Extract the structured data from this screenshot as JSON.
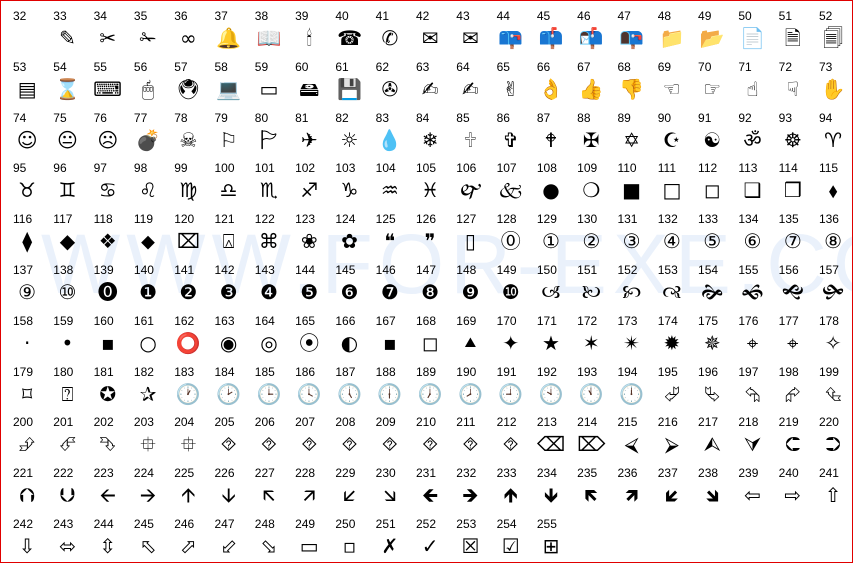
{
  "watermark": "WWW.FOR-EXE.COM",
  "symbols": [
    {
      "code": "32",
      "glyph": ""
    },
    {
      "code": "33",
      "glyph": "✎"
    },
    {
      "code": "34",
      "glyph": "✂"
    },
    {
      "code": "35",
      "glyph": "✁"
    },
    {
      "code": "36",
      "glyph": "∞"
    },
    {
      "code": "37",
      "glyph": "🔔"
    },
    {
      "code": "38",
      "glyph": "📖"
    },
    {
      "code": "39",
      "glyph": "🕯"
    },
    {
      "code": "40",
      "glyph": "☎"
    },
    {
      "code": "41",
      "glyph": "✆"
    },
    {
      "code": "42",
      "glyph": "✉"
    },
    {
      "code": "43",
      "glyph": "✉"
    },
    {
      "code": "44",
      "glyph": "📪"
    },
    {
      "code": "45",
      "glyph": "📫"
    },
    {
      "code": "46",
      "glyph": "📬"
    },
    {
      "code": "47",
      "glyph": "📭"
    },
    {
      "code": "48",
      "glyph": "📁"
    },
    {
      "code": "49",
      "glyph": "📂"
    },
    {
      "code": "50",
      "glyph": "📄"
    },
    {
      "code": "51",
      "glyph": "🗎"
    },
    {
      "code": "52",
      "glyph": "🗐"
    },
    {
      "code": "53",
      "glyph": "▤"
    },
    {
      "code": "54",
      "glyph": "⌛"
    },
    {
      "code": "55",
      "glyph": "⌨"
    },
    {
      "code": "56",
      "glyph": "🖱"
    },
    {
      "code": "57",
      "glyph": "🖲"
    },
    {
      "code": "58",
      "glyph": "💻"
    },
    {
      "code": "59",
      "glyph": "▭"
    },
    {
      "code": "60",
      "glyph": "🖴"
    },
    {
      "code": "61",
      "glyph": "💾"
    },
    {
      "code": "62",
      "glyph": "✇"
    },
    {
      "code": "63",
      "glyph": "✍"
    },
    {
      "code": "64",
      "glyph": "✍"
    },
    {
      "code": "65",
      "glyph": "✌"
    },
    {
      "code": "66",
      "glyph": "👌"
    },
    {
      "code": "67",
      "glyph": "👍"
    },
    {
      "code": "68",
      "glyph": "👎"
    },
    {
      "code": "69",
      "glyph": "☜"
    },
    {
      "code": "70",
      "glyph": "☞"
    },
    {
      "code": "71",
      "glyph": "☝"
    },
    {
      "code": "72",
      "glyph": "☟"
    },
    {
      "code": "73",
      "glyph": "✋"
    },
    {
      "code": "74",
      "glyph": "☺"
    },
    {
      "code": "75",
      "glyph": "😐"
    },
    {
      "code": "76",
      "glyph": "☹"
    },
    {
      "code": "77",
      "glyph": "💣"
    },
    {
      "code": "78",
      "glyph": "☠"
    },
    {
      "code": "79",
      "glyph": "⚐"
    },
    {
      "code": "80",
      "glyph": "🏱"
    },
    {
      "code": "81",
      "glyph": "✈"
    },
    {
      "code": "82",
      "glyph": "☼"
    },
    {
      "code": "83",
      "glyph": "💧"
    },
    {
      "code": "84",
      "glyph": "❄"
    },
    {
      "code": "85",
      "glyph": "🕆"
    },
    {
      "code": "86",
      "glyph": "✞"
    },
    {
      "code": "87",
      "glyph": "🕈"
    },
    {
      "code": "88",
      "glyph": "✠"
    },
    {
      "code": "89",
      "glyph": "✡"
    },
    {
      "code": "90",
      "glyph": "☪"
    },
    {
      "code": "91",
      "glyph": "☯"
    },
    {
      "code": "92",
      "glyph": "ॐ"
    },
    {
      "code": "93",
      "glyph": "☸"
    },
    {
      "code": "94",
      "glyph": "♈"
    },
    {
      "code": "95",
      "glyph": "♉"
    },
    {
      "code": "96",
      "glyph": "♊"
    },
    {
      "code": "97",
      "glyph": "♋"
    },
    {
      "code": "98",
      "glyph": "♌"
    },
    {
      "code": "99",
      "glyph": "♍"
    },
    {
      "code": "100",
      "glyph": "♎"
    },
    {
      "code": "101",
      "glyph": "♏"
    },
    {
      "code": "102",
      "glyph": "♐"
    },
    {
      "code": "103",
      "glyph": "♑"
    },
    {
      "code": "104",
      "glyph": "♒"
    },
    {
      "code": "105",
      "glyph": "♓"
    },
    {
      "code": "106",
      "glyph": "🙰"
    },
    {
      "code": "107",
      "glyph": "🙵"
    },
    {
      "code": "108",
      "glyph": "●"
    },
    {
      "code": "109",
      "glyph": "❍"
    },
    {
      "code": "110",
      "glyph": "■"
    },
    {
      "code": "111",
      "glyph": "□"
    },
    {
      "code": "112",
      "glyph": "◻"
    },
    {
      "code": "113",
      "glyph": "❑"
    },
    {
      "code": "114",
      "glyph": "❒"
    },
    {
      "code": "115",
      "glyph": "⬧"
    },
    {
      "code": "116",
      "glyph": "⧫"
    },
    {
      "code": "117",
      "glyph": "◆"
    },
    {
      "code": "118",
      "glyph": "❖"
    },
    {
      "code": "119",
      "glyph": "⬥"
    },
    {
      "code": "120",
      "glyph": "⌧"
    },
    {
      "code": "121",
      "glyph": "⍓"
    },
    {
      "code": "122",
      "glyph": "⌘"
    },
    {
      "code": "123",
      "glyph": "❀"
    },
    {
      "code": "124",
      "glyph": "✿"
    },
    {
      "code": "125",
      "glyph": "❝"
    },
    {
      "code": "126",
      "glyph": "❞"
    },
    {
      "code": "127",
      "glyph": "▯"
    },
    {
      "code": "128",
      "glyph": "⓪"
    },
    {
      "code": "129",
      "glyph": "①"
    },
    {
      "code": "130",
      "glyph": "②"
    },
    {
      "code": "131",
      "glyph": "③"
    },
    {
      "code": "132",
      "glyph": "④"
    },
    {
      "code": "133",
      "glyph": "⑤"
    },
    {
      "code": "134",
      "glyph": "⑥"
    },
    {
      "code": "135",
      "glyph": "⑦"
    },
    {
      "code": "136",
      "glyph": "⑧"
    },
    {
      "code": "137",
      "glyph": "⑨"
    },
    {
      "code": "138",
      "glyph": "⑩"
    },
    {
      "code": "139",
      "glyph": "⓿"
    },
    {
      "code": "140",
      "glyph": "❶"
    },
    {
      "code": "141",
      "glyph": "❷"
    },
    {
      "code": "142",
      "glyph": "❸"
    },
    {
      "code": "143",
      "glyph": "❹"
    },
    {
      "code": "144",
      "glyph": "❺"
    },
    {
      "code": "145",
      "glyph": "❻"
    },
    {
      "code": "146",
      "glyph": "❼"
    },
    {
      "code": "147",
      "glyph": "❽"
    },
    {
      "code": "148",
      "glyph": "❾"
    },
    {
      "code": "149",
      "glyph": "❿"
    },
    {
      "code": "150",
      "glyph": "🙢"
    },
    {
      "code": "151",
      "glyph": "🙠"
    },
    {
      "code": "152",
      "glyph": "🙡"
    },
    {
      "code": "153",
      "glyph": "🙣"
    },
    {
      "code": "154",
      "glyph": "🙞"
    },
    {
      "code": "155",
      "glyph": "🙜"
    },
    {
      "code": "156",
      "glyph": "🙝"
    },
    {
      "code": "157",
      "glyph": "🙟"
    },
    {
      "code": "158",
      "glyph": "·"
    },
    {
      "code": "159",
      "glyph": "•"
    },
    {
      "code": "160",
      "glyph": "▪"
    },
    {
      "code": "161",
      "glyph": "○"
    },
    {
      "code": "162",
      "glyph": "⭕"
    },
    {
      "code": "163",
      "glyph": "◉"
    },
    {
      "code": "164",
      "glyph": "◎"
    },
    {
      "code": "165",
      "glyph": "⦿"
    },
    {
      "code": "166",
      "glyph": "◐"
    },
    {
      "code": "167",
      "glyph": "▪"
    },
    {
      "code": "168",
      "glyph": "◻"
    },
    {
      "code": "169",
      "glyph": "⯅"
    },
    {
      "code": "170",
      "glyph": "✦"
    },
    {
      "code": "171",
      "glyph": "★"
    },
    {
      "code": "172",
      "glyph": "✶"
    },
    {
      "code": "173",
      "glyph": "✴"
    },
    {
      "code": "174",
      "glyph": "✹"
    },
    {
      "code": "175",
      "glyph": "✵"
    },
    {
      "code": "176",
      "glyph": "⌖"
    },
    {
      "code": "177",
      "glyph": "⌖"
    },
    {
      "code": "178",
      "glyph": "✧"
    },
    {
      "code": "179",
      "glyph": "⌑"
    },
    {
      "code": "180",
      "glyph": "⍰"
    },
    {
      "code": "181",
      "glyph": "✪"
    },
    {
      "code": "182",
      "glyph": "✰"
    },
    {
      "code": "183",
      "glyph": "🕐"
    },
    {
      "code": "184",
      "glyph": "🕑"
    },
    {
      "code": "185",
      "glyph": "🕒"
    },
    {
      "code": "186",
      "glyph": "🕓"
    },
    {
      "code": "187",
      "glyph": "🕔"
    },
    {
      "code": "188",
      "glyph": "🕕"
    },
    {
      "code": "189",
      "glyph": "🕖"
    },
    {
      "code": "190",
      "glyph": "🕗"
    },
    {
      "code": "191",
      "glyph": "🕘"
    },
    {
      "code": "192",
      "glyph": "🕙"
    },
    {
      "code": "193",
      "glyph": "🕚"
    },
    {
      "code": "194",
      "glyph": "🕛"
    },
    {
      "code": "195",
      "glyph": "⮰"
    },
    {
      "code": "196",
      "glyph": "⮱"
    },
    {
      "code": "197",
      "glyph": "⮲"
    },
    {
      "code": "198",
      "glyph": "⮳"
    },
    {
      "code": "199",
      "glyph": "⮴"
    },
    {
      "code": "200",
      "glyph": "⮵"
    },
    {
      "code": "201",
      "glyph": "⮶"
    },
    {
      "code": "202",
      "glyph": "⮷"
    },
    {
      "code": "203",
      "glyph": "⯐"
    },
    {
      "code": "204",
      "glyph": "⯐"
    },
    {
      "code": "205",
      "glyph": "⯑"
    },
    {
      "code": "206",
      "glyph": "⯑"
    },
    {
      "code": "207",
      "glyph": "⯑"
    },
    {
      "code": "208",
      "glyph": "⯑"
    },
    {
      "code": "209",
      "glyph": "⯑"
    },
    {
      "code": "210",
      "glyph": "⯑"
    },
    {
      "code": "211",
      "glyph": "⯑"
    },
    {
      "code": "212",
      "glyph": "⯑"
    },
    {
      "code": "213",
      "glyph": "⌫"
    },
    {
      "code": "214",
      "glyph": "⌦"
    },
    {
      "code": "215",
      "glyph": "⮘"
    },
    {
      "code": "216",
      "glyph": "⮚"
    },
    {
      "code": "217",
      "glyph": "⮙"
    },
    {
      "code": "218",
      "glyph": "⮛"
    },
    {
      "code": "219",
      "glyph": "⮈"
    },
    {
      "code": "220",
      "glyph": "⮊"
    },
    {
      "code": "221",
      "glyph": "⮉"
    },
    {
      "code": "222",
      "glyph": "⮋"
    },
    {
      "code": "223",
      "glyph": "🡨"
    },
    {
      "code": "224",
      "glyph": "🡪"
    },
    {
      "code": "225",
      "glyph": "🡩"
    },
    {
      "code": "226",
      "glyph": "🡫"
    },
    {
      "code": "227",
      "glyph": "🡬"
    },
    {
      "code": "228",
      "glyph": "🡭"
    },
    {
      "code": "229",
      "glyph": "🡯"
    },
    {
      "code": "230",
      "glyph": "🡮"
    },
    {
      "code": "231",
      "glyph": "🡸"
    },
    {
      "code": "232",
      "glyph": "🡺"
    },
    {
      "code": "233",
      "glyph": "🡹"
    },
    {
      "code": "234",
      "glyph": "🡻"
    },
    {
      "code": "235",
      "glyph": "🡼"
    },
    {
      "code": "236",
      "glyph": "🡽"
    },
    {
      "code": "237",
      "glyph": "🡿"
    },
    {
      "code": "238",
      "glyph": "🡾"
    },
    {
      "code": "239",
      "glyph": "⇦"
    },
    {
      "code": "240",
      "glyph": "⇨"
    },
    {
      "code": "241",
      "glyph": "⇧"
    },
    {
      "code": "242",
      "glyph": "⇩"
    },
    {
      "code": "243",
      "glyph": "⬄"
    },
    {
      "code": "244",
      "glyph": "⇳"
    },
    {
      "code": "245",
      "glyph": "⬁"
    },
    {
      "code": "246",
      "glyph": "⬀"
    },
    {
      "code": "247",
      "glyph": "⬃"
    },
    {
      "code": "248",
      "glyph": "⬂"
    },
    {
      "code": "249",
      "glyph": "▭"
    },
    {
      "code": "250",
      "glyph": "▫"
    },
    {
      "code": "251",
      "glyph": "✗"
    },
    {
      "code": "252",
      "glyph": "✓"
    },
    {
      "code": "253",
      "glyph": "☒"
    },
    {
      "code": "254",
      "glyph": "☑"
    },
    {
      "code": "255",
      "glyph": "⊞"
    }
  ]
}
